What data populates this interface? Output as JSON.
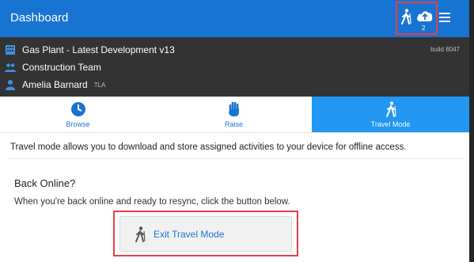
{
  "header": {
    "title": "Dashboard",
    "sync_badge": "2"
  },
  "info": {
    "project": "Gas Plant - Latest Development v13",
    "build": "build 8047",
    "team": "Construction Team",
    "user": "Amelia Barnard",
    "user_initials": "TLA"
  },
  "tabs": [
    {
      "label": "Browse",
      "icon": "clock-icon"
    },
    {
      "label": "Raise",
      "icon": "hand-icon"
    },
    {
      "label": "Travel Mode",
      "icon": "hiker-icon",
      "active": true
    }
  ],
  "main": {
    "description": "Travel mode allows you to download and store assigned activities to your device for offline access.",
    "back_title": "Back Online?",
    "back_text": "When you're back online and ready to resync, click the button below.",
    "exit_button": "Exit Travel Mode"
  },
  "colors": {
    "primary": "#1874d2",
    "tab_active": "#2196f3",
    "dark_bar": "#333333",
    "highlight": "#e53f4a"
  }
}
